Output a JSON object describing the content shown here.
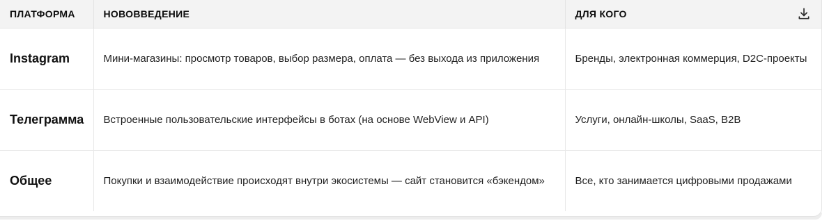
{
  "table": {
    "headers": [
      "ПЛАТФОРМА",
      "НОВОВВЕДЕНИЕ",
      "ДЛЯ КОГО"
    ],
    "download_icon": "download-icon",
    "rows": [
      {
        "platform": "Instagram",
        "innovation": "Мини-магазины: просмотр товаров, выбор размера, оплата — без выхода из приложения",
        "audience": "Бренды, электронная коммерция, D2C-проекты"
      },
      {
        "platform": "Телеграмма",
        "innovation": "Встроенные пользовательские интерфейсы в ботах (на основе WebView и API)",
        "audience": "Услуги, онлайн-школы, SaaS, B2B"
      },
      {
        "platform": "Общее",
        "innovation": "Покупки и взаимодействие происходят внутри экосистемы — сайт становится «бэкендом»",
        "audience": "Все, кто занимается цифровыми продажами"
      }
    ]
  }
}
